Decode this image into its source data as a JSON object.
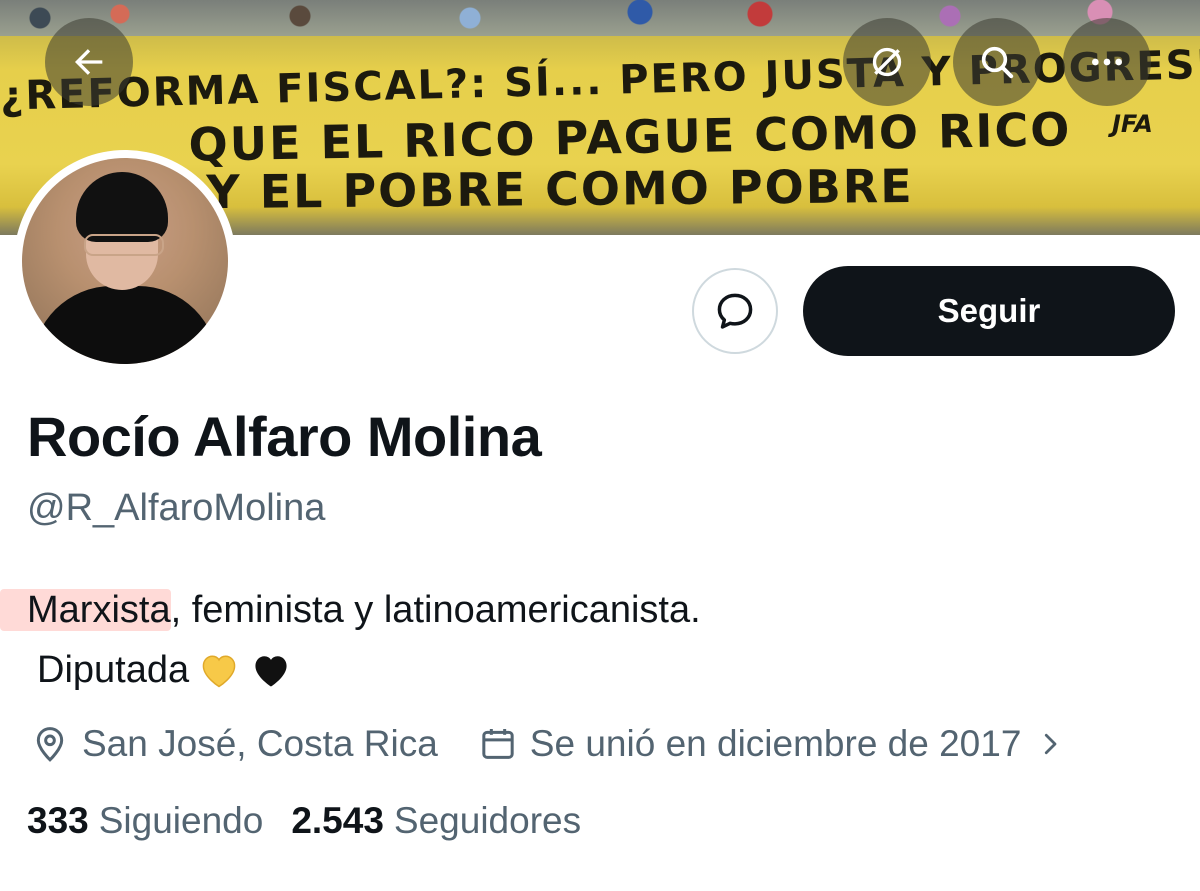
{
  "banner": {
    "line1": "¿REFORMA FISCAL?: SÍ... PERO JUSTA Y PROGRESIVA",
    "line2": "QUE EL RICO PAGUE COMO RICO",
    "line3": "Y EL POBRE COMO POBRE",
    "logo_text": "JFA"
  },
  "nav": {
    "back_icon": "arrow-left-icon",
    "grok_icon": "slash-circle-icon",
    "search_icon": "search-icon",
    "more_icon": "more-dots-icon"
  },
  "actions": {
    "message_icon": "chat-bubble-icon",
    "follow_label": "Seguir"
  },
  "profile": {
    "name": "Rocío Alfaro Molina",
    "handle": "@R_AlfaroMolina",
    "bio_highlight": "Marxista",
    "bio_rest": ", feminista y latinoamericanista.",
    "bio_line2": "Diputada",
    "bio_emojis": [
      "💛",
      "🖤"
    ],
    "location": "San José, Costa Rica",
    "joined": "Se unió en diciembre de 2017"
  },
  "stats": {
    "following_count": "333",
    "following_label": "Siguiendo",
    "followers_count": "2.543",
    "followers_label": "Seguidores"
  },
  "colors": {
    "text_primary": "#0f1419",
    "text_secondary": "#536471",
    "button_dark": "#0f1419",
    "highlight": "#ffb3a8",
    "banner_yellow": "#e6cf4b"
  }
}
